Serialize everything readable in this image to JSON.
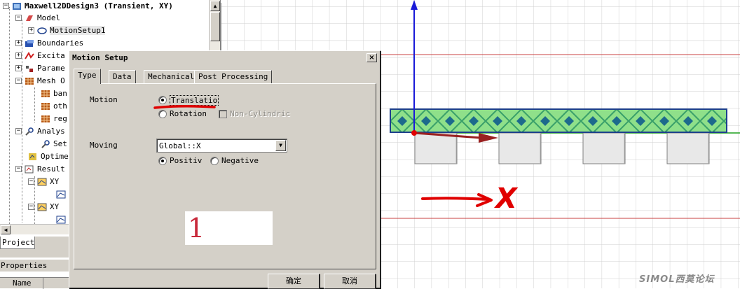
{
  "project_tree": {
    "root": "Maxwell2DDesign3 (Transient, XY)",
    "items": [
      "Model",
      "MotionSetup1",
      "Boundaries",
      "Excita",
      "Parame",
      "Mesh O",
      "ban",
      "oth",
      "reg",
      "Analys",
      "Set",
      "Optime",
      "Result",
      "XY",
      "XY"
    ]
  },
  "panel_tabs": {
    "project": "Project",
    "properties": "Properties",
    "name_column": "Name"
  },
  "dialog": {
    "title": "Motion Setup",
    "close_glyph": "×",
    "tabs": [
      "Type",
      "Data",
      "Mechanical",
      "Post Processing"
    ],
    "active_tab": "Type",
    "motion_label": "Motion",
    "translation_label": "Translatio",
    "rotation_label": "Rotation",
    "non_cylindric_label": "Non-Cylindric",
    "moving_label": "Moving",
    "moving_value": "Global::X",
    "positive_label": "Positiv",
    "negative_label": "Negative",
    "annotation_number": "1",
    "ok_label": "确定",
    "cancel_label": "取消"
  },
  "canvas": {
    "annotation_axis": "X",
    "watermark": "SIMOL西莫论坛"
  },
  "colors": {
    "dialog_bg": "#d4d0c8",
    "annotation_red": "#e00000",
    "band_green": "#8fe08a",
    "band_blue": "#1d3f8c"
  }
}
